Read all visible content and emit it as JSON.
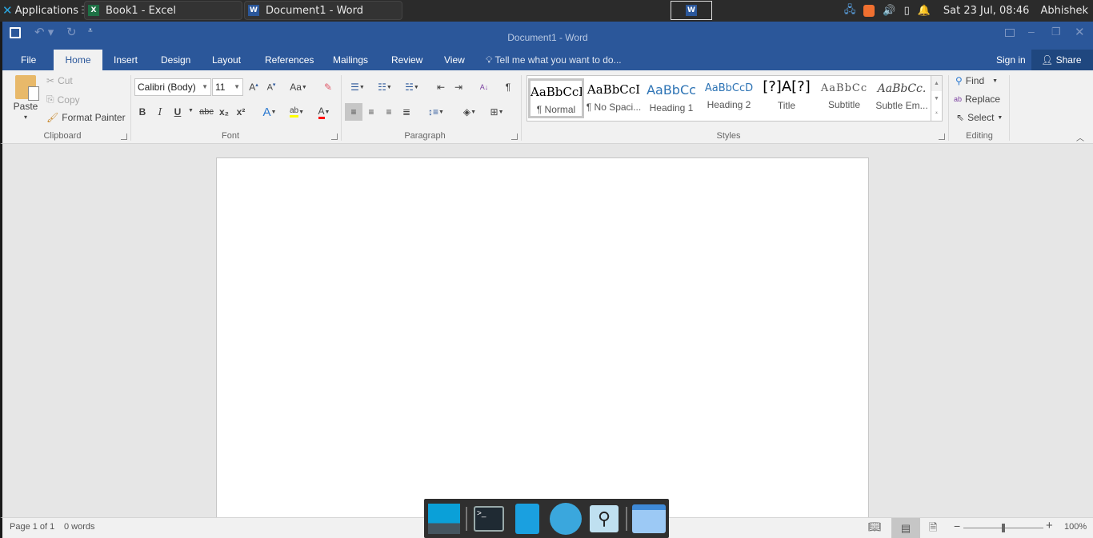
{
  "taskbar": {
    "applications_label": "Applications",
    "tasks": [
      {
        "label": "Book1 - Excel",
        "icon": "excel-icon"
      },
      {
        "label": "Document1 - Word",
        "icon": "word-icon"
      }
    ],
    "clock": "Sat 23 Jul, 08:46",
    "user": "Abhishek"
  },
  "window": {
    "title": "Document1 - Word",
    "quick_access": [
      "save",
      "undo",
      "redo",
      "customize"
    ]
  },
  "tabs": [
    "File",
    "Home",
    "Insert",
    "Design",
    "Layout",
    "References",
    "Mailings",
    "Review",
    "View"
  ],
  "active_tab": "Home",
  "tell_me": "Tell me what you want to do...",
  "sign_in": "Sign in",
  "share": "Share",
  "clipboard": {
    "paste": "Paste",
    "cut": "Cut",
    "copy": "Copy",
    "format_painter": "Format Painter",
    "label": "Clipboard"
  },
  "font": {
    "name": "Calibri (Body)",
    "size": "11",
    "change_case": "Aa",
    "label": "Font",
    "bold": "B",
    "italic": "I",
    "underline": "U",
    "strikethrough": "abc",
    "subscript": "x₂",
    "superscript": "x²"
  },
  "paragraph": {
    "label": "Paragraph",
    "pilcrow": "¶"
  },
  "styles": {
    "label": "Styles",
    "items": [
      {
        "preview": "AaBbCcI",
        "name": "¶ Normal"
      },
      {
        "preview": "AaBbCcI",
        "name": "¶ No Spaci..."
      },
      {
        "preview": "AaBbCc",
        "name": "Heading 1"
      },
      {
        "preview": "AaBbCcD",
        "name": "Heading 2"
      },
      {
        "preview": "[?]A[?]",
        "name": "Title"
      },
      {
        "preview": "AaBbCc",
        "name": "Subtitle"
      },
      {
        "preview": "AaBbCc.",
        "name": "Subtle Em..."
      }
    ]
  },
  "editing": {
    "find": "Find",
    "replace": "Replace",
    "select": "Select",
    "label": "Editing"
  },
  "status": {
    "page": "Page 1 of 1",
    "words": "0 words",
    "zoom": "100%",
    "zoom_value_percent": 100
  },
  "colors": {
    "word_blue": "#2b579a",
    "highlight": "#ffff00",
    "font_color": "#ff0000"
  }
}
